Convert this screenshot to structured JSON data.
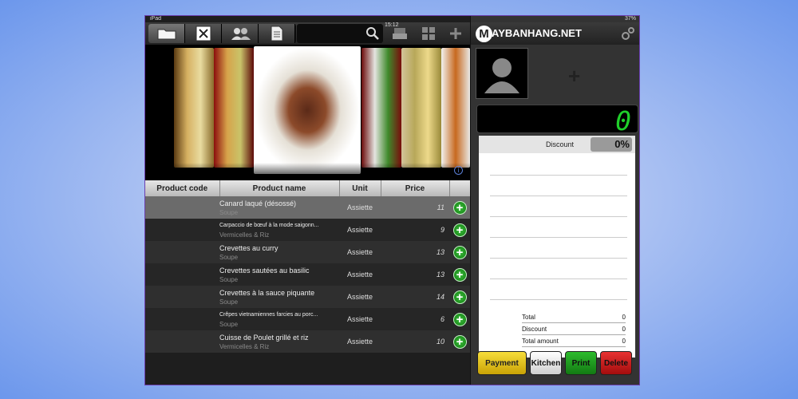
{
  "statusbar": {
    "carrier": "iPad",
    "time": "15:12",
    "battery": "37%"
  },
  "toolbar": {
    "buttons": [
      "folder-icon",
      "utensils-icon",
      "users-icon",
      "document-icon"
    ],
    "search_icon": "search-icon",
    "right_icons": [
      "printer-icon",
      "grid-icon",
      "plus-icon"
    ]
  },
  "brand": {
    "logo_letter": "M",
    "name": "AYBANHANG.NET"
  },
  "table": {
    "headers": [
      "Product code",
      "Product name",
      "Unit",
      "Price"
    ],
    "rows": [
      {
        "code": "",
        "name": "Canard laqué (désossé)",
        "category": "Soupe",
        "unit": "Assiette",
        "price": "11"
      },
      {
        "code": "",
        "name": "Carpaccio de bœuf à la mode saigonn...",
        "category": "Vermicelles & Riz",
        "unit": "Assiette",
        "price": "9"
      },
      {
        "code": "",
        "name": "Crevettes au curry",
        "category": "Soupe",
        "unit": "Assiette",
        "price": "13"
      },
      {
        "code": "",
        "name": "Crevettes sautées au basilic",
        "category": "Soupe",
        "unit": "Assiette",
        "price": "13"
      },
      {
        "code": "",
        "name": "Crevettes à la sauce piquante",
        "category": "Soupe",
        "unit": "Assiette",
        "price": "14"
      },
      {
        "code": "",
        "name": "Crêpes vietnamiennes farcies au porc...",
        "category": "Soupe",
        "unit": "Assiette",
        "price": "6"
      },
      {
        "code": "",
        "name": "Cuisse de Poulet grillé et riz",
        "category": "Vermicelles & Riz",
        "unit": "Assiette",
        "price": "10"
      }
    ]
  },
  "order": {
    "display_total": "0",
    "discount_label": "Discount",
    "discount_value": "0%",
    "totals": [
      {
        "label": "Total",
        "value": "0"
      },
      {
        "label": "Discount",
        "value": "0"
      },
      {
        "label": "Total amount",
        "value": "0"
      }
    ]
  },
  "actions": {
    "payment": "Payment",
    "kitchen": "Kitchen",
    "print": "Print",
    "delete": "Delete"
  },
  "colors": {
    "payment": "#e8c20c",
    "kitchen": "#f2f2f2",
    "print": "#1e9e1e",
    "delete": "#d01a1a",
    "display_digits": "#1fcf2a"
  }
}
